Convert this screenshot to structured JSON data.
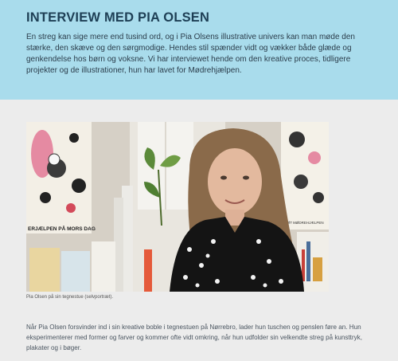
{
  "header": {
    "title": "INTERVIEW MED PIA OLSEN",
    "intro": "En streg kan sige mere end tusind ord, og i Pia Olsens illustrative univers kan man møde den stærke, den skæve og den sørgmodige. Hendes stil spænder vidt og vækker både glæde og genkendelse hos børn og voksne. Vi har interviewet hende om den kreative proces, tidligere projekter og de illustrationer, hun har lavet for Mødrehjælpen."
  },
  "photo": {
    "poster_left_text": "ERJÆLPEN PÅ MORS DAG",
    "poster_right_text": "STØT MØDREHJÆLPEN",
    "caption": "Pia Olsen på sin tegnestue (selvportræt)."
  },
  "article": {
    "paragraph": "Når Pia Olsen forsvinder ind i sin kreative boble i tegnestuen på Nørrebro, lader hun tuschen og penslen føre an. Hun eksperimenterer med former og farver og kommer ofte vidt omkring, når hun udfolder sin velkendte streg på kunsttryk, plakater og i bøger."
  },
  "colors": {
    "header_bg": "#a9dcec",
    "title": "#1e3f55",
    "page_bg": "#ececec"
  }
}
